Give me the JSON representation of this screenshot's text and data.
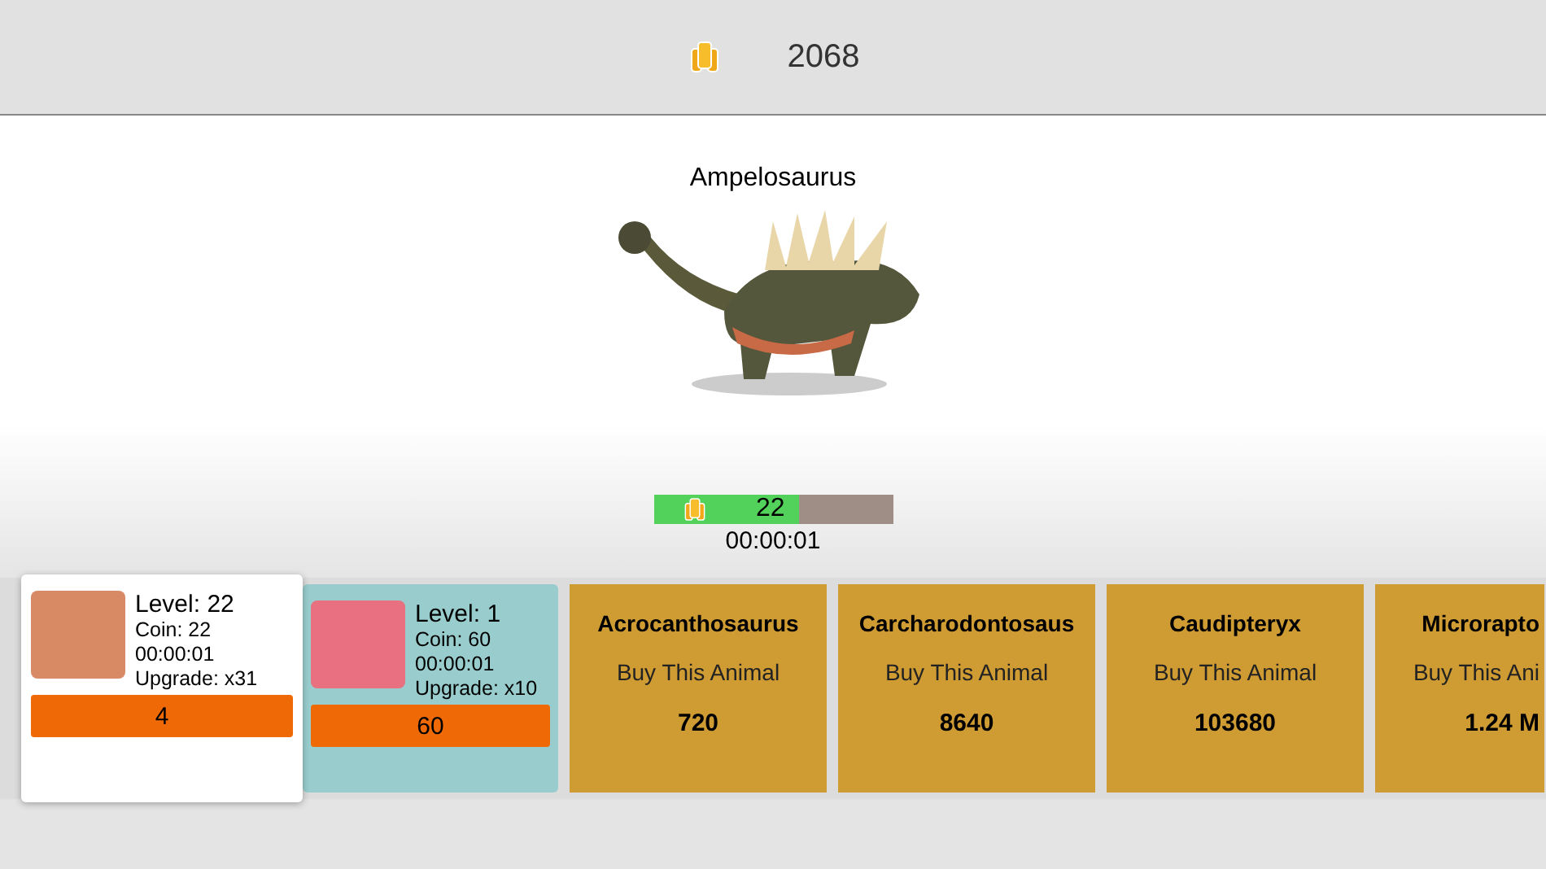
{
  "header": {
    "coins": "2068"
  },
  "animal": {
    "name": "Ampelosaurus",
    "progress": {
      "level": 0.61,
      "value": "22"
    },
    "timer": "00:00:01"
  },
  "cards": [
    {
      "kind": "owned",
      "selected": true,
      "level": "Level: 22",
      "coin": "Coin: 22",
      "time": "00:00:01",
      "upgrade": "Upgrade: x31",
      "button": "4"
    },
    {
      "kind": "owned",
      "selected": false,
      "level": "Level: 1",
      "coin": "Coin: 60",
      "time": "00:00:01",
      "upgrade": "Upgrade: x10",
      "button": "60"
    },
    {
      "kind": "buy",
      "name": "Acrocanthosaurus",
      "action": "Buy This Animal",
      "price": "720"
    },
    {
      "kind": "buy",
      "name": "Carcharodontosaus",
      "action": "Buy This Animal",
      "price": "8640"
    },
    {
      "kind": "buy",
      "name": "Caudipteryx",
      "action": "Buy This Animal",
      "price": "103680"
    },
    {
      "kind": "buy",
      "name": "Microrapto",
      "action": "Buy This Ani",
      "price": "1.24 M",
      "cut": true
    }
  ]
}
